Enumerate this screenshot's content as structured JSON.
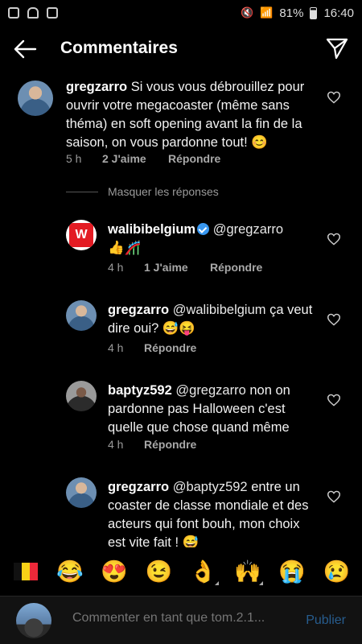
{
  "status_bar": {
    "battery": "81%",
    "time": "16:40"
  },
  "header": {
    "title": "Commentaires"
  },
  "comments": [
    {
      "username": "gregzarro",
      "text": "Si vous vous débrouillez pour ouvrir votre megacoaster (même sans théma) en soft opening avant la fin de la saison, on vous pardonne tout! 😊",
      "time": "5 h",
      "likes": "2 J'aime",
      "reply": "Répondre"
    }
  ],
  "hide_replies": "Masquer les réponses",
  "replies": [
    {
      "username": "walibibelgium",
      "verified": true,
      "mention": "@gregzarro",
      "text": "👍🎢",
      "time": "4 h",
      "likes": "1 J'aime",
      "reply": "Répondre"
    },
    {
      "username": "gregzarro",
      "mention": "@walibibelgium",
      "text": "ça veut dire oui? 😅😝",
      "time": "4 h",
      "reply": "Répondre"
    },
    {
      "username": "baptyz592",
      "mention": "@gregzarro",
      "text": "non on pardonne pas Halloween c'est quelle que chose quand même",
      "time": "4 h",
      "reply": "Répondre"
    },
    {
      "username": "gregzarro",
      "mention": "@baptyz592",
      "text": "entre un coaster de classe mondiale et des acteurs qui font bouh, mon choix est vite fait ! 😅"
    }
  ],
  "emoji_bar": [
    "😂",
    "😍",
    "😉",
    "👌",
    "🙌",
    "😭",
    "😢"
  ],
  "input": {
    "placeholder": "Commenter en tant que tom.2.1...",
    "publish": "Publier"
  },
  "walibi_logo_text": "W"
}
